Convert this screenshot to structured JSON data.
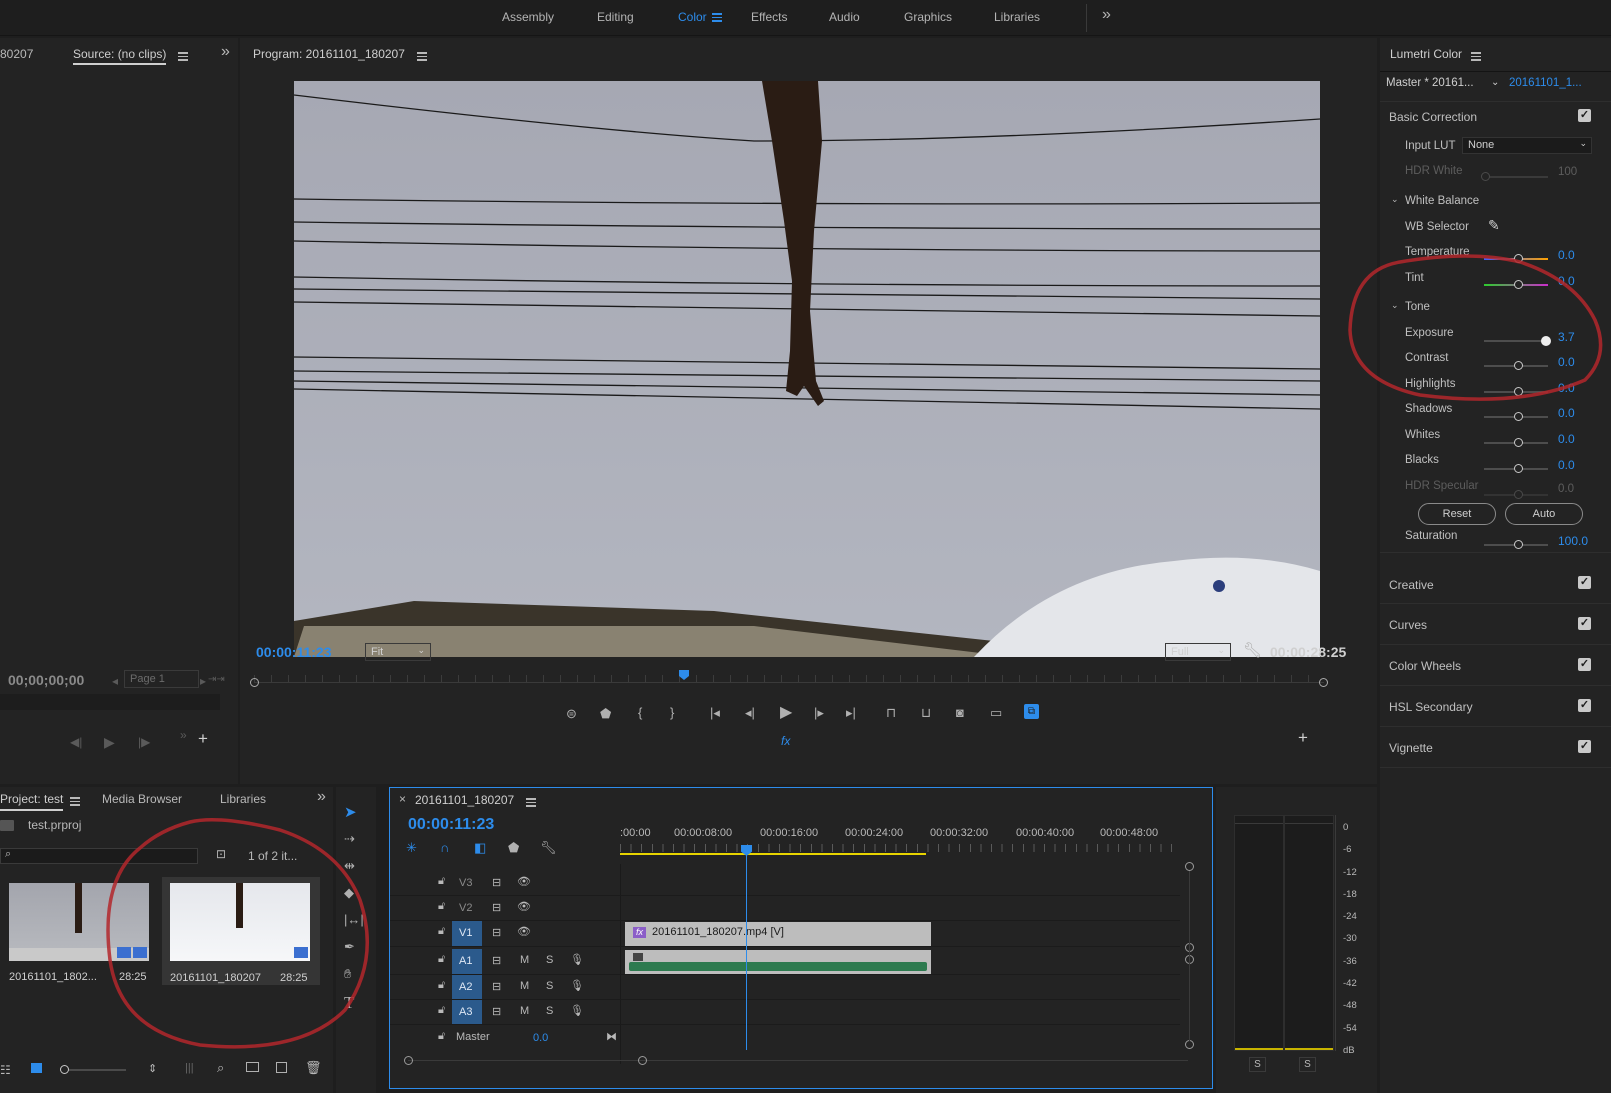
{
  "workspaces": {
    "tabs": [
      "Assembly",
      "Editing",
      "Color",
      "Effects",
      "Audio",
      "Graphics",
      "Libraries"
    ],
    "active": "Color",
    "more": "»"
  },
  "source": {
    "prev_label": "80207",
    "tab": "Source: (no clips)",
    "timecode": "00;00;00;00",
    "page": "Page 1",
    "more": "»"
  },
  "program": {
    "title": "Program: 20161101_180207",
    "timecode": "00:00:11:23",
    "zoom": "Fit",
    "quality": "Full",
    "duration": "00:00:28:25",
    "fx": "fx",
    "playhead_fraction": 0.404
  },
  "lumetri": {
    "title": "Lumetri Color",
    "master": "Master * 20161...",
    "clip": "20161101_1...",
    "basic_correction": "Basic Correction",
    "input_lut_label": "Input LUT",
    "input_lut_value": "None",
    "hdr_white_label": "HDR White",
    "hdr_white_value": "100",
    "white_balance": "White Balance",
    "wb_selector": "WB Selector",
    "temperature": {
      "label": "Temperature",
      "value": "0.0"
    },
    "tint": {
      "label": "Tint",
      "value": "0.0"
    },
    "tone": "Tone",
    "exposure": {
      "label": "Exposure",
      "value": "3.7"
    },
    "contrast": {
      "label": "Contrast",
      "value": "0.0"
    },
    "highlights": {
      "label": "Highlights",
      "value": "0.0"
    },
    "shadows": {
      "label": "Shadows",
      "value": "0.0"
    },
    "whites": {
      "label": "Whites",
      "value": "0.0"
    },
    "blacks": {
      "label": "Blacks",
      "value": "0.0"
    },
    "hdr_specular": {
      "label": "HDR Specular",
      "value": "0.0"
    },
    "reset": "Reset",
    "auto": "Auto",
    "saturation": {
      "label": "Saturation",
      "value": "100.0"
    },
    "sections": [
      "Creative",
      "Curves",
      "Color Wheels",
      "HSL Secondary",
      "Vignette"
    ]
  },
  "project": {
    "tabs": [
      "Project: test",
      "Media Browser",
      "Libraries"
    ],
    "file": "test.prproj",
    "count": "1 of 2 it...",
    "items": [
      {
        "name": "20161101_1802...",
        "dur": "28:25"
      },
      {
        "name": "20161101_180207",
        "dur": "28:25"
      }
    ],
    "more": "»"
  },
  "timeline": {
    "close": "×",
    "title": "20161101_180207",
    "timecode": "00:00:11:23",
    "ruler": [
      ":00:00",
      "00:00:08:00",
      "00:00:16:00",
      "00:00:24:00",
      "00:00:32:00",
      "00:00:40:00",
      "00:00:48:00"
    ],
    "video_tracks": [
      "V3",
      "V2",
      "V1"
    ],
    "audio_tracks": [
      "A1",
      "A2",
      "A3"
    ],
    "m": "M",
    "s": "S",
    "master_label": "Master",
    "master_value": "0.0",
    "clip_label": "20161101_180207.mp4 [V]",
    "fx": "fx"
  },
  "meter": {
    "scale": [
      "0",
      "-6",
      "-12",
      "-18",
      "-24",
      "-30",
      "-36",
      "-42",
      "-48",
      "-54",
      "dB"
    ],
    "solo": [
      "S",
      "S"
    ]
  },
  "colors": {
    "accent": "#2d8ceb",
    "panel": "#232323",
    "bg": "#1e1e1e",
    "annotation": "#b3272b"
  }
}
